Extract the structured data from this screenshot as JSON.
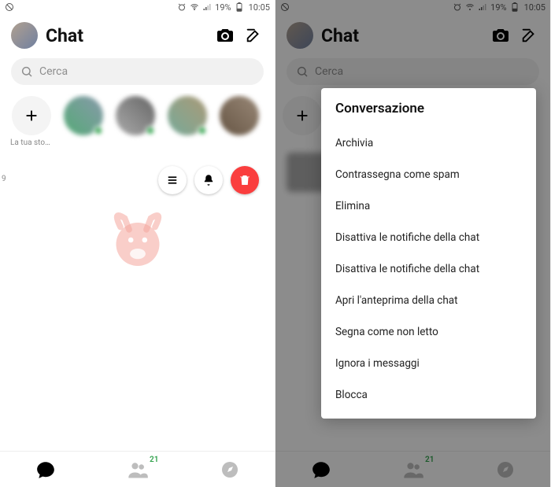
{
  "status": {
    "battery_pct": "19%",
    "time": "10:05"
  },
  "header": {
    "title": "Chat"
  },
  "search": {
    "placeholder": "Cerca"
  },
  "stories": {
    "add_label": "La tua storia"
  },
  "swipe": {
    "more_label": "more",
    "mute_label": "mute",
    "delete_label": "delete"
  },
  "nav": {
    "badge_count": "21"
  },
  "menu": {
    "title": "Conversazione",
    "items": [
      "Archivia",
      "Contrassegna come spam",
      "Elimina",
      "Disattiva le notifiche della chat",
      "Disattiva le notifiche della chat",
      "Apri l'anteprima della chat",
      "Segna come non letto",
      "Ignora i messaggi",
      "Blocca"
    ]
  },
  "misc": {
    "stray_digit": "9"
  }
}
